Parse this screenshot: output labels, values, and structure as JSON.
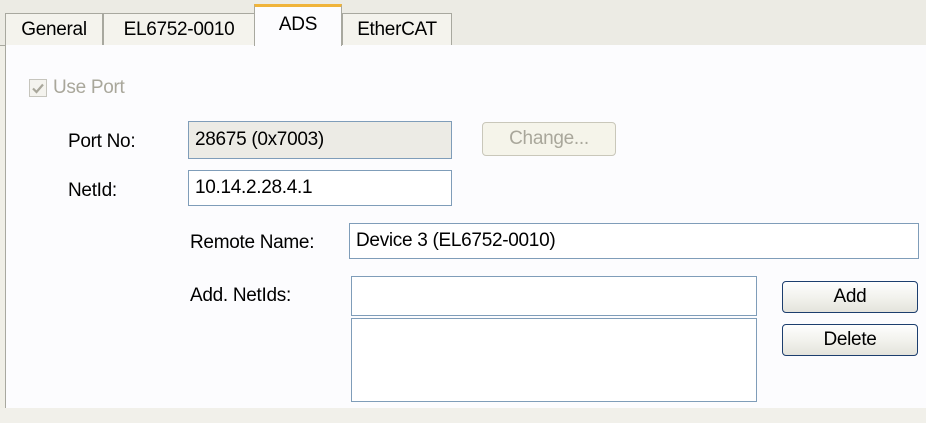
{
  "tabs": [
    {
      "label": "General"
    },
    {
      "label": "EL6752-0010"
    },
    {
      "label": "ADS"
    },
    {
      "label": "EtherCAT"
    }
  ],
  "use_port": {
    "label": "Use Port",
    "checked": true,
    "enabled": false
  },
  "port_no": {
    "label": "Port No:",
    "value": "28675 (0x7003)",
    "change_button": "Change..."
  },
  "netid": {
    "label": "NetId:",
    "value": "10.14.2.28.4.1"
  },
  "remote_name": {
    "label": "Remote Name:",
    "value": "Device 3 (EL6752-0010)"
  },
  "add_netids": {
    "label": "Add. NetIds:",
    "input_value": "",
    "add_button": "Add",
    "delete_button": "Delete"
  },
  "colors": {
    "active_tab_accent": "#f0b43a",
    "input_border": "#7f9db9",
    "disabled_text": "#a9a79b",
    "panel_background": "#fcfcfe"
  },
  "icons": {
    "checkbox": "check-icon"
  }
}
